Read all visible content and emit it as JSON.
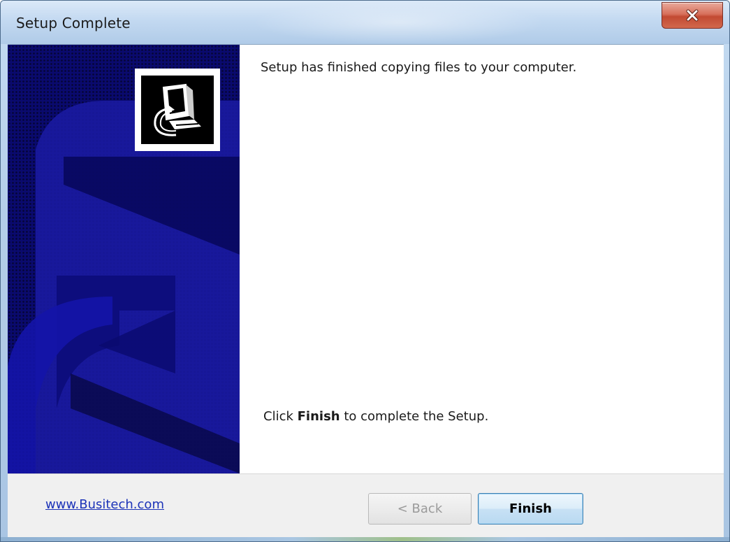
{
  "window": {
    "title": "Setup Complete"
  },
  "content": {
    "message": "Setup has finished copying files to your computer.",
    "hint_prefix": "Click ",
    "hint_bold": "Finish",
    "hint_suffix": " to complete the Setup."
  },
  "footer": {
    "link_text": "www.Busitech.com",
    "back_label": "< Back",
    "finish_label": "Finish"
  },
  "colors": {
    "side_panel": "#0a0a6e",
    "link": "#1c33b8",
    "close_button": "#c24a32"
  },
  "icons": {
    "close": "close-icon",
    "setup_logo": "computer-install-icon"
  },
  "state": {
    "back_enabled": false,
    "finish_default": true
  }
}
